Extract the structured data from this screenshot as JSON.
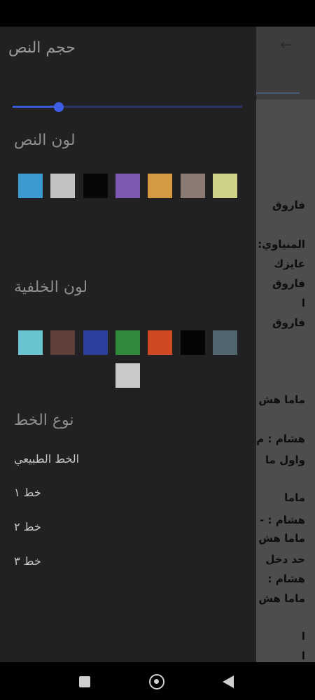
{
  "drawer": {
    "text_size": {
      "title": "حجم النص",
      "value_fraction": 0.2
    },
    "text_color": {
      "title": "لون النص",
      "swatches": [
        "#3b9ad0",
        "#c2c2c2",
        "#070707",
        "#7e59b3",
        "#d49a42",
        "#8a7a72",
        "#ced085"
      ]
    },
    "background_color": {
      "title": "لون الخلفية",
      "swatches": [
        "#6ac4cf",
        "#5f3f38",
        "#2a3f9e",
        "#2f8b3b",
        "#cf4a21",
        "#050505",
        "#51656f",
        "#c9c9c9"
      ]
    },
    "font_type": {
      "title": "نوع الخط",
      "options": [
        "الخط الطبيعي",
        "خط ١",
        "خط ٢",
        "خط ٣"
      ]
    }
  },
  "background_page": {
    "lines": [
      "فاروق",
      "المنياوي:",
      "عايزك",
      "فاروق",
      "ا",
      "فاروق",
      "ماما هش",
      "هشام : م",
      "واول ما",
      "ماما",
      "هشام : -",
      "ماما هش",
      "حد دخل",
      "هشام :",
      "ماما هش",
      "ا",
      "ا"
    ]
  }
}
